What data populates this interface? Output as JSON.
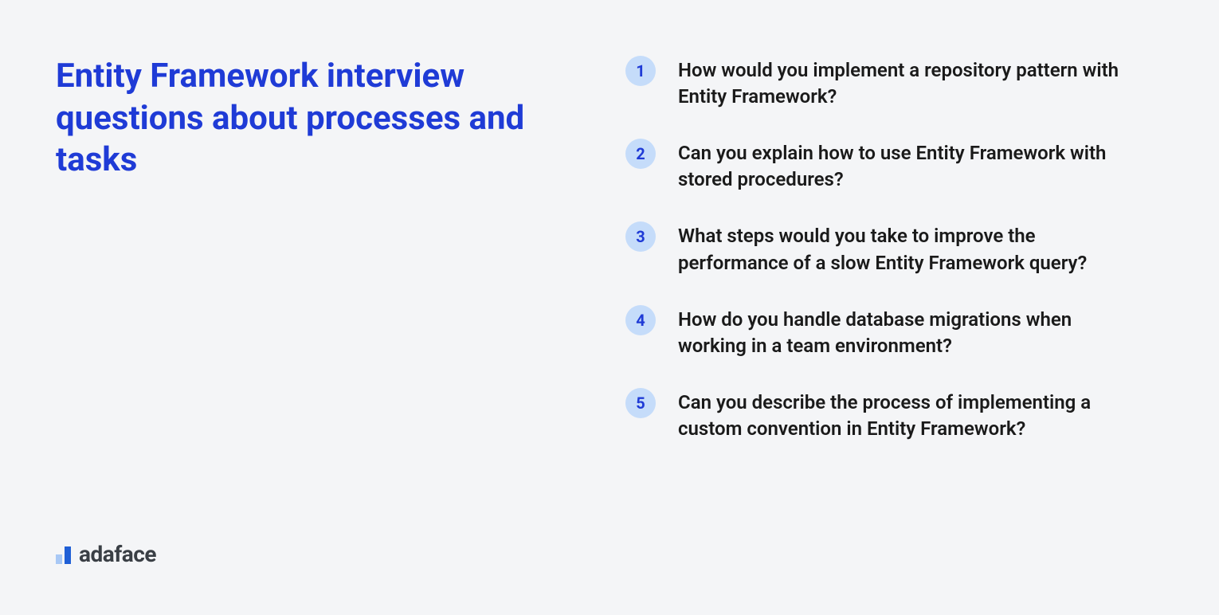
{
  "heading": "Entity Framework interview questions about processes and tasks",
  "brand": {
    "name": "adaface"
  },
  "questions": [
    {
      "number": "1",
      "text": "How would you implement a repository pattern with Entity Framework?"
    },
    {
      "number": "2",
      "text": "Can you explain how to use Entity Framework with stored procedures?"
    },
    {
      "number": "3",
      "text": "What steps would you take to improve the performance of a slow Entity Framework query?"
    },
    {
      "number": "4",
      "text": "How do you handle database migrations when working in a team environment?"
    },
    {
      "number": "5",
      "text": "Can you describe the process of implementing a custom convention in Entity Framework?"
    }
  ]
}
